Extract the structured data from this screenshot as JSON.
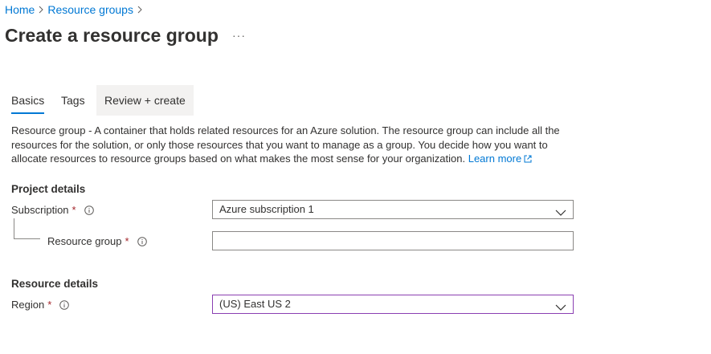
{
  "breadcrumb": {
    "home": "Home",
    "resource_groups": "Resource groups"
  },
  "page": {
    "title": "Create a resource group",
    "more": "···"
  },
  "tabs": [
    {
      "label": "Basics",
      "active": true
    },
    {
      "label": "Tags",
      "active": false
    },
    {
      "label": "Review + create",
      "active": false
    }
  ],
  "description": {
    "term": "Resource group",
    "text": " - A container that holds related resources for an Azure solution. The resource group can include all the resources for the solution, or only those resources that you want to manage as a group. You decide how you want to allocate resources to resource groups based on what makes the most sense for your organization.",
    "learn_more": "Learn more"
  },
  "project_details": {
    "heading": "Project details",
    "subscription": {
      "label": "Subscription",
      "required": "*",
      "value": "Azure subscription 1"
    },
    "resource_group": {
      "label": "Resource group",
      "required": "*",
      "value": "",
      "placeholder": ""
    }
  },
  "resource_details": {
    "heading": "Resource details",
    "region": {
      "label": "Region",
      "required": "*",
      "value": "(US) East US 2"
    }
  },
  "colors": {
    "link": "#0078d4",
    "accent": "#0078d4",
    "required": "#a4262c",
    "focus_border": "#8a3fb2",
    "text": "#323130"
  },
  "icons": {
    "separator": "chevron-right-icon",
    "info": "info-icon",
    "dropdown": "chevron-down-icon",
    "external": "external-link-icon"
  }
}
